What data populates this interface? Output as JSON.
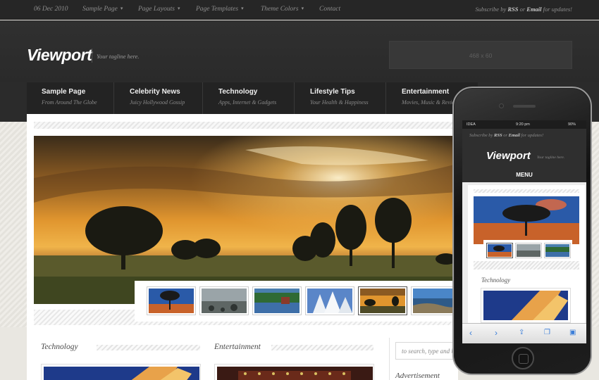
{
  "topbar": {
    "date": "06 Dec 2010",
    "menu": [
      {
        "label": "Sample Page",
        "has_dropdown": true
      },
      {
        "label": "Page Layouts",
        "has_dropdown": true
      },
      {
        "label": "Page Templates",
        "has_dropdown": true
      },
      {
        "label": "Theme Colors",
        "has_dropdown": true
      },
      {
        "label": "Contact",
        "has_dropdown": false
      }
    ],
    "chevron": "▾",
    "subscribe": {
      "prefix": "Subscribe by ",
      "rss": "RSS",
      "or": " or ",
      "email": "Email",
      "suffix": " for updates!"
    }
  },
  "header": {
    "logo": "Viewport",
    "tagline": "Your tagline here.",
    "ad_label": "468 x 60"
  },
  "nav": [
    {
      "title": "Sample Page",
      "subtitle": "From Around The Globe"
    },
    {
      "title": "Celebrity News",
      "subtitle": "Juicy Hollywood Gossip"
    },
    {
      "title": "Technology",
      "subtitle": "Apps, Internet & Gadgets"
    },
    {
      "title": "Lifestyle Tips",
      "subtitle": "Your Health & Happiness"
    },
    {
      "title": "Entertainment",
      "subtitle": "Movies, Music & Reviews"
    }
  ],
  "slider": {
    "active_thumb": 4,
    "thumbs": [
      "tree-sunset-thumb",
      "rocky-beach-thumb",
      "lake-house-thumb",
      "snowy-trees-thumb",
      "sunset-field-thumb",
      "coast-sky-thumb"
    ]
  },
  "sections": {
    "left": "Technology",
    "middle": "Entertainment",
    "sidebar_title": "Advertisement"
  },
  "search": {
    "placeholder": "to search, type and hit enter"
  },
  "phone": {
    "status": {
      "carrier": "IDEA",
      "time": "9:20 pm",
      "battery": "90%"
    },
    "subscribe": {
      "prefix": "Subscribe by ",
      "rss": "RSS",
      "or": " or ",
      "email": "Email",
      "suffix": " for updates!"
    },
    "logo": "Viewport",
    "tagline": "Your tagline here.",
    "menu": "MENU",
    "section": "Technology",
    "toolbar_icons": [
      "back-icon",
      "forward-icon",
      "share-icon",
      "bookmarks-icon",
      "tabs-icon"
    ]
  },
  "colors": {
    "accent": "#262626",
    "page_bg": "#e9e7e1",
    "ios_blue": "#3b7ed8"
  }
}
